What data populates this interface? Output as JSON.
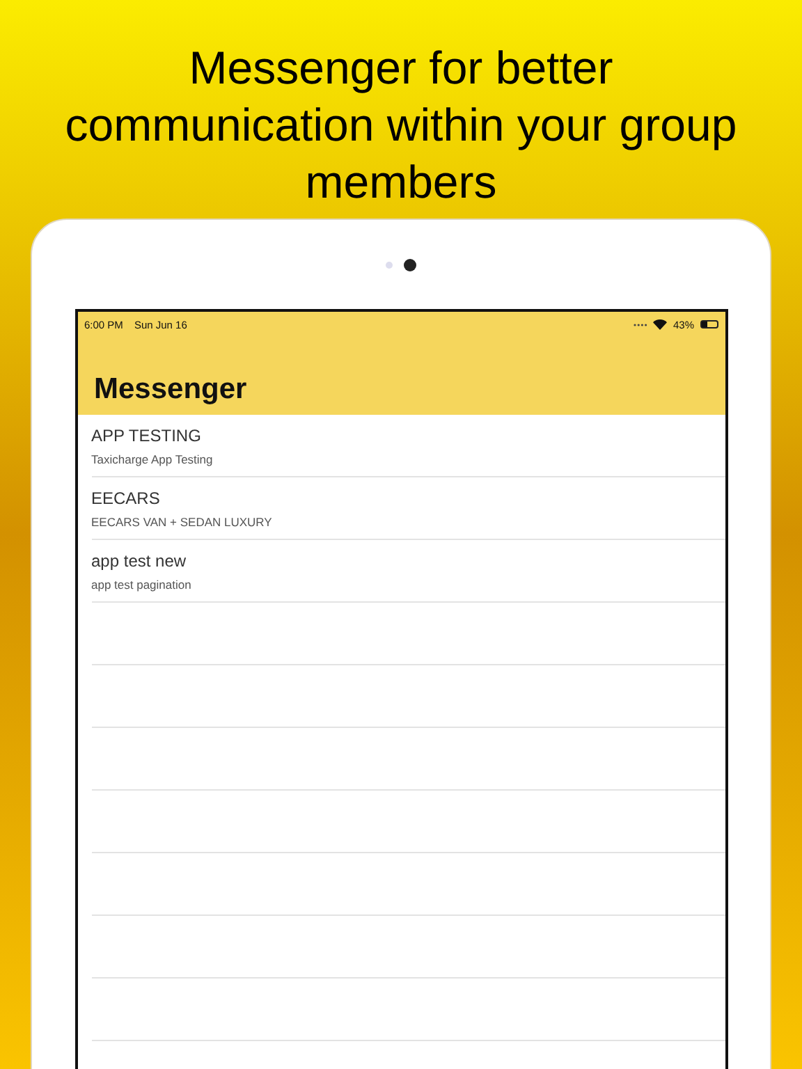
{
  "headline": "Messenger for better communication within your group members",
  "status_bar": {
    "time": "6:00 PM",
    "date": "Sun Jun 16",
    "battery_text": "43%",
    "level": 0.43
  },
  "nav": {
    "title": "Messenger"
  },
  "chats": [
    {
      "name": "APP TESTING",
      "subtitle": "Taxicharge App Testing"
    },
    {
      "name": "EECARS",
      "subtitle": "EECARS VAN + SEDAN LUXURY"
    },
    {
      "name": "app test new",
      "subtitle": "app test pagination"
    }
  ]
}
